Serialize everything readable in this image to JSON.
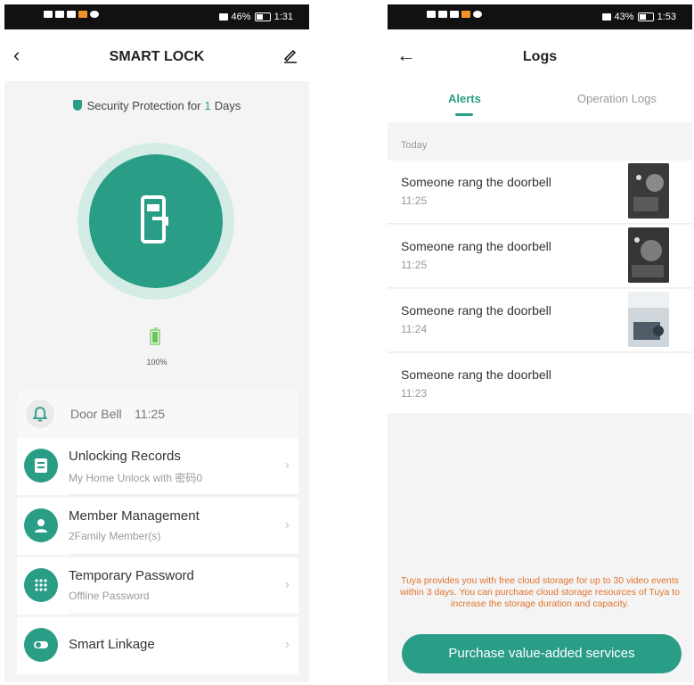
{
  "left": {
    "status": {
      "battery": "46%",
      "time": "1:31"
    },
    "nav": {
      "title": "SMART LOCK"
    },
    "security": {
      "prefix": "Security Protection for",
      "days": "1",
      "suffix": "Days"
    },
    "battery_text": "100%",
    "battery_level": 1.0,
    "doorbell": {
      "label": "Door Bell",
      "time": "11:25"
    },
    "menu": [
      {
        "title": "Unlocking Records",
        "subtitle": "My Home Unlock with 密码0",
        "icon": "record-icon"
      },
      {
        "title": "Member Management",
        "subtitle": "2Family Member(s)",
        "icon": "person-icon"
      },
      {
        "title": "Temporary Password",
        "subtitle": "Offline Password",
        "icon": "keypad-icon"
      },
      {
        "title": "Smart Linkage",
        "subtitle": "",
        "icon": "toggle-icon"
      }
    ]
  },
  "right": {
    "status": {
      "battery": "43%",
      "time": "1:53"
    },
    "nav": {
      "title": "Logs"
    },
    "tabs": [
      "Alerts",
      "Operation Logs"
    ],
    "today_label": "Today",
    "logs": [
      {
        "text": "Someone rang the doorbell",
        "time": "11:25"
      },
      {
        "text": "Someone rang the doorbell",
        "time": "11:25"
      },
      {
        "text": "Someone rang the doorbell",
        "time": "11:24"
      },
      {
        "text": "Someone rang the doorbell",
        "time": "11:23"
      }
    ],
    "notice": "Tuya provides you with free cloud storage for up to 30 video events within 3 days. You can purchase cloud storage resources of Tuya to increase the storage duration and capacity.",
    "purchase_label": "Purchase value-added services"
  },
  "colors": {
    "accent": "#2a9d87",
    "notice": "#e0742e",
    "ring": "#d4ece6"
  }
}
